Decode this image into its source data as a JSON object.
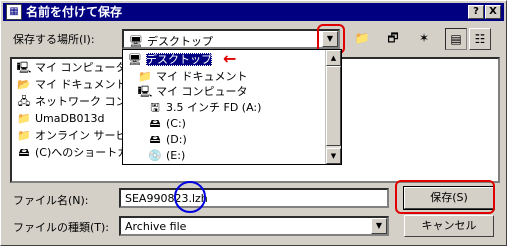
{
  "window": {
    "title": "名前を付けて保存",
    "help_btn": "?",
    "close_btn": "X"
  },
  "save_location": {
    "label": "保存する場所(I):",
    "value": "デスクトップ"
  },
  "toolbar": {
    "icons": [
      "up-folder-icon",
      "desktop-icon",
      "new-folder-icon",
      "list-view-icon",
      "details-view-icon"
    ]
  },
  "file_list": [
    {
      "icon": "my-computer-icon",
      "label": "マイ コンピュータ"
    },
    {
      "icon": "my-documents-icon",
      "label": "マイ ドキュメント"
    },
    {
      "icon": "network-icon",
      "label": "ネットワーク コンピュータ"
    },
    {
      "icon": "folder-icon",
      "label": "UmaDB013d"
    },
    {
      "icon": "folder-icon",
      "label": "オンライン サービス"
    },
    {
      "icon": "shortcut-icon",
      "label": "(C)へのショートカット"
    }
  ],
  "dropdown": {
    "items": [
      {
        "icon": "desktop-icon",
        "label": "デスクトップ",
        "level": 0,
        "selected": true
      },
      {
        "icon": "folder-icon",
        "label": "マイ ドキュメント",
        "level": 1
      },
      {
        "icon": "my-computer-icon",
        "label": "マイ コンピュータ",
        "level": 1
      },
      {
        "icon": "floppy-icon",
        "label": "3.5 インチ FD (A:)",
        "level": 2
      },
      {
        "icon": "drive-icon",
        "label": "(C:)",
        "level": 2
      },
      {
        "icon": "drive-icon",
        "label": "(D:)",
        "level": 2
      },
      {
        "icon": "cdrom-icon",
        "label": "(E:)",
        "level": 2
      }
    ]
  },
  "filename": {
    "label": "ファイル名(N):",
    "value": "SEA990823.lzh"
  },
  "filetype": {
    "label": "ファイルの種類(T):",
    "value": "Archive file"
  },
  "buttons": {
    "save": "保存(S)",
    "cancel": "キャンセル"
  },
  "annotations": {
    "red_color": "#e00000",
    "blue_color": "#0000e0",
    "arrow": "←"
  }
}
